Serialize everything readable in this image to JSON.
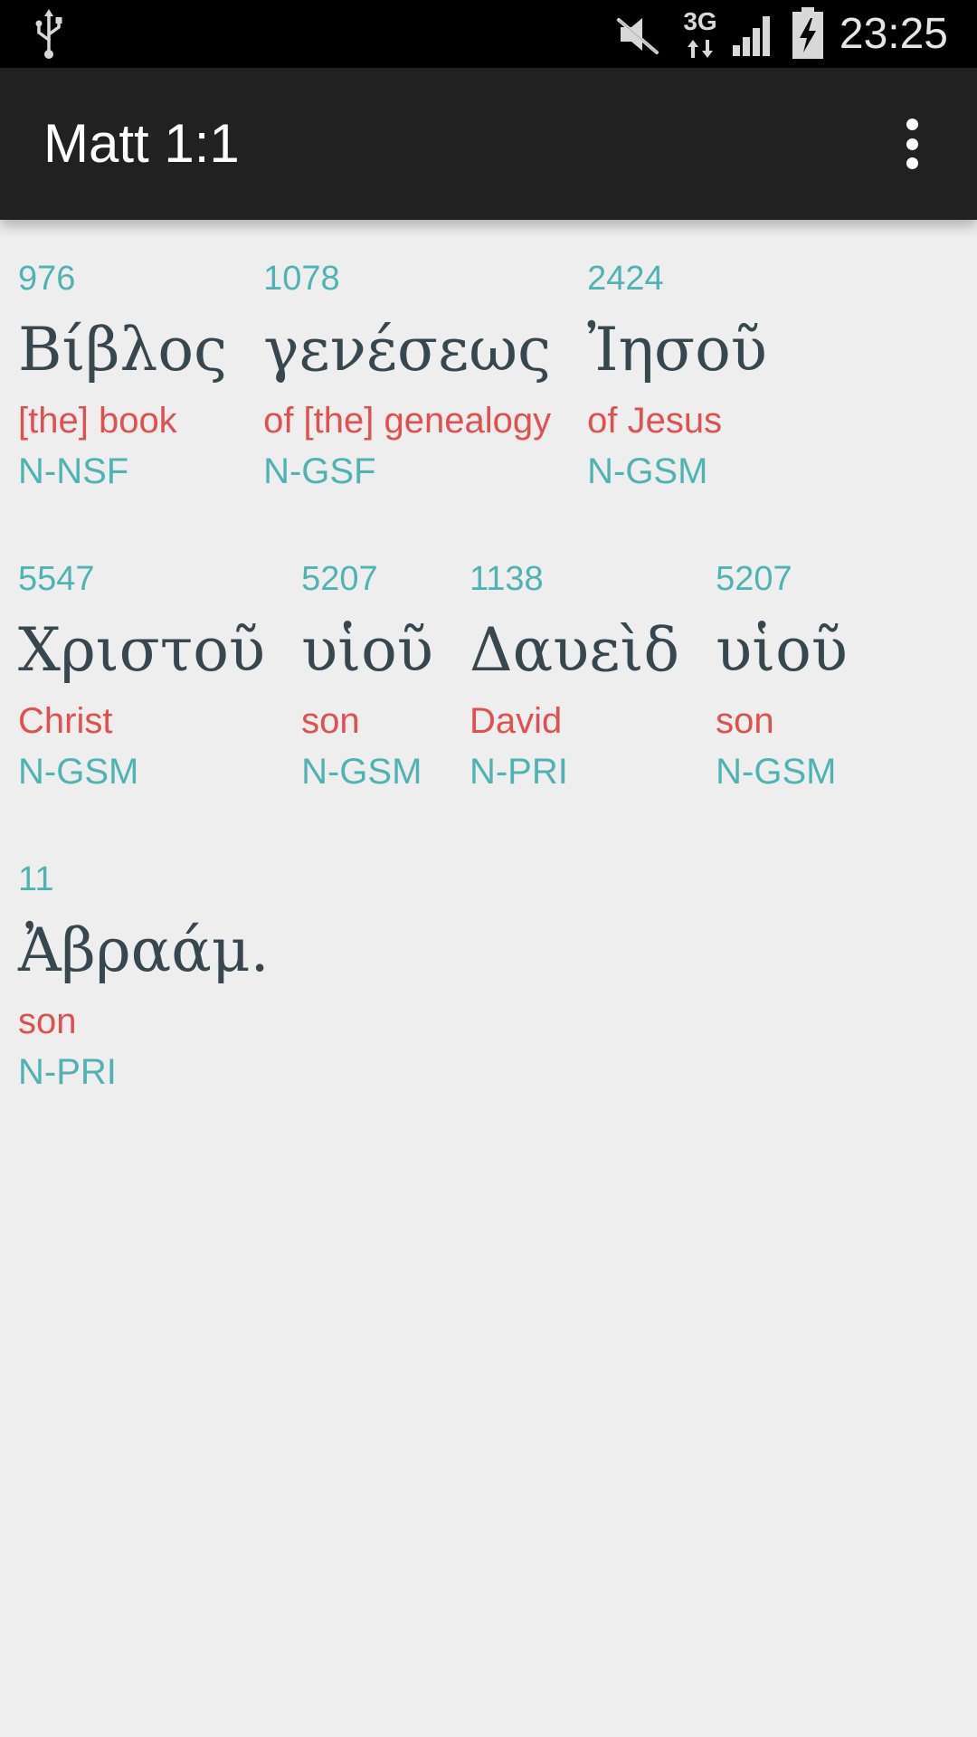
{
  "status_bar": {
    "network_type": "3G",
    "time": "23:25",
    "icons": [
      "usb-icon",
      "mute-icon",
      "data-arrows-icon",
      "signal-icon",
      "battery-charging-icon"
    ]
  },
  "app_bar": {
    "title": "Matt 1:1",
    "overflow_icon": "more-vert-icon"
  },
  "words": [
    {
      "strongs": "976",
      "greek": "Βίβλος",
      "gloss": "[the] book",
      "parsing": "N-NSF"
    },
    {
      "strongs": "1078",
      "greek": "γενέσεως",
      "gloss": "of [the] genealogy",
      "parsing": "N-GSF"
    },
    {
      "strongs": "2424",
      "greek": "Ἰησοῦ",
      "gloss": "of Jesus",
      "parsing": "N-GSM"
    },
    {
      "strongs": "5547",
      "greek": "Χριστοῦ",
      "gloss": "Christ",
      "parsing": "N-GSM"
    },
    {
      "strongs": "5207",
      "greek": "υἱοῦ",
      "gloss": "son",
      "parsing": "N-GSM"
    },
    {
      "strongs": "1138",
      "greek": "Δαυεὶδ",
      "gloss": "David",
      "parsing": "N-PRI"
    },
    {
      "strongs": "5207",
      "greek": "υἱοῦ",
      "gloss": "son",
      "parsing": "N-GSM"
    },
    {
      "strongs": "11",
      "greek": "Ἀβραάμ.",
      "gloss": "son",
      "parsing": "N-PRI"
    }
  ],
  "colors": {
    "status_bar": "#000000",
    "app_bar": "#212121",
    "background": "#eeeeee",
    "strongs": "#4fb3b3",
    "greek": "#37474f",
    "gloss": "#e0504e",
    "parsing": "#4fb3b3"
  }
}
